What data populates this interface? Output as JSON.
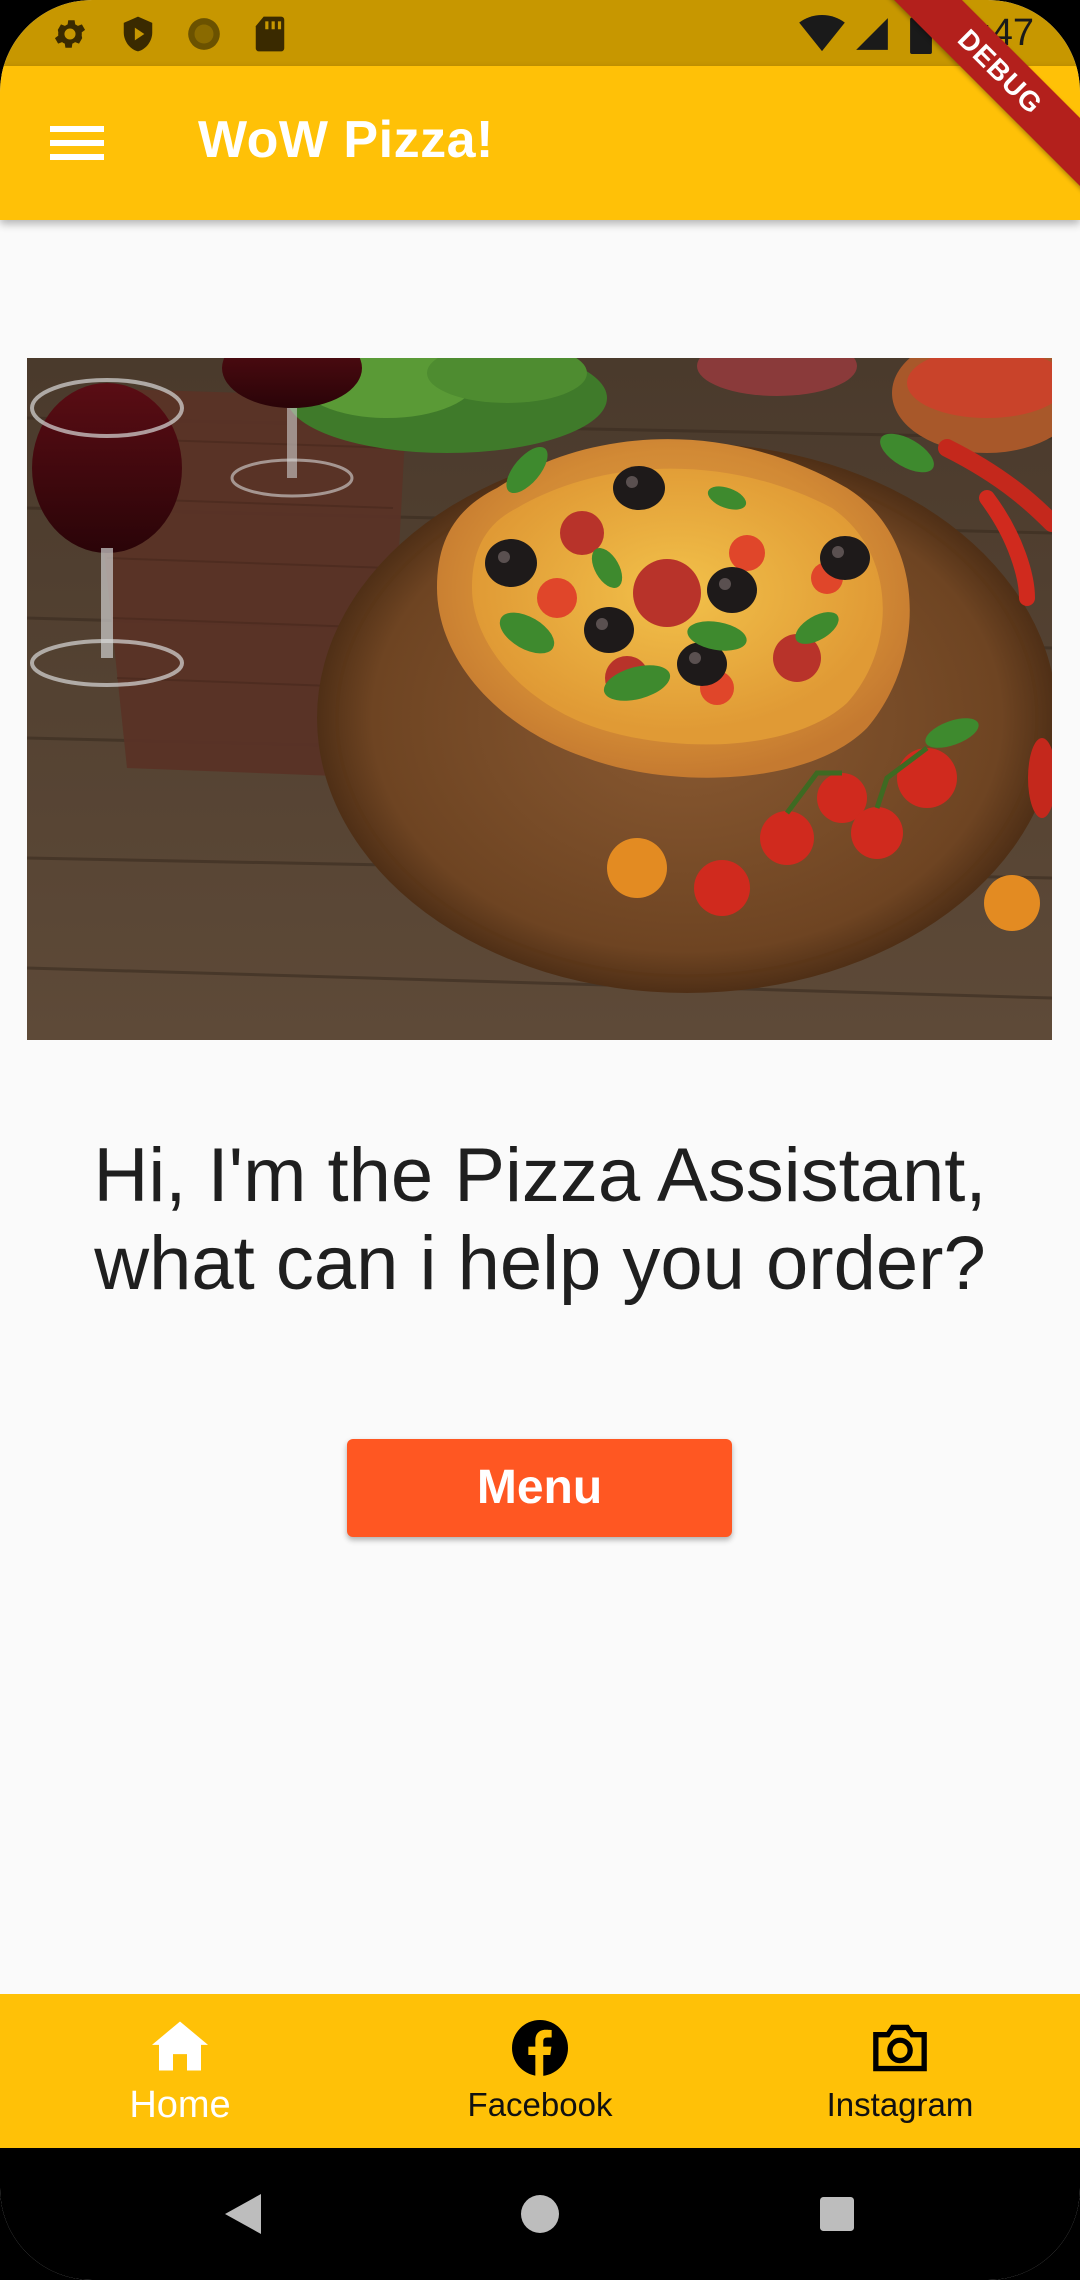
{
  "status_bar": {
    "time": "7:47",
    "left_icons": [
      "gear-icon",
      "shield-play-icon",
      "circle-icon",
      "sd-card-icon"
    ],
    "right_icons": [
      "wifi-icon",
      "signal-icon",
      "battery-icon"
    ]
  },
  "debug_banner": "DEBUG",
  "app_bar": {
    "title": "WoW Pizza!",
    "menu_icon": "hamburger-menu-icon"
  },
  "hero": {
    "image": "pizza-photo"
  },
  "greeting": {
    "line1": "Hi, I'm the Pizza Assistant,",
    "line2": "what can i help you order?"
  },
  "menu_button": {
    "label": "Menu"
  },
  "bottom_nav": {
    "items": [
      {
        "label": "Home",
        "icon": "home-icon",
        "active": true
      },
      {
        "label": "Facebook",
        "icon": "facebook-icon",
        "active": false
      },
      {
        "label": "Instagram",
        "icon": "camera-icon",
        "active": false
      }
    ]
  },
  "colors": {
    "status_bar": "#c79700",
    "app_bar": "#ffc107",
    "button": "#ff5722",
    "background": "#fafafa",
    "debug_ribbon": "#b3201c"
  }
}
